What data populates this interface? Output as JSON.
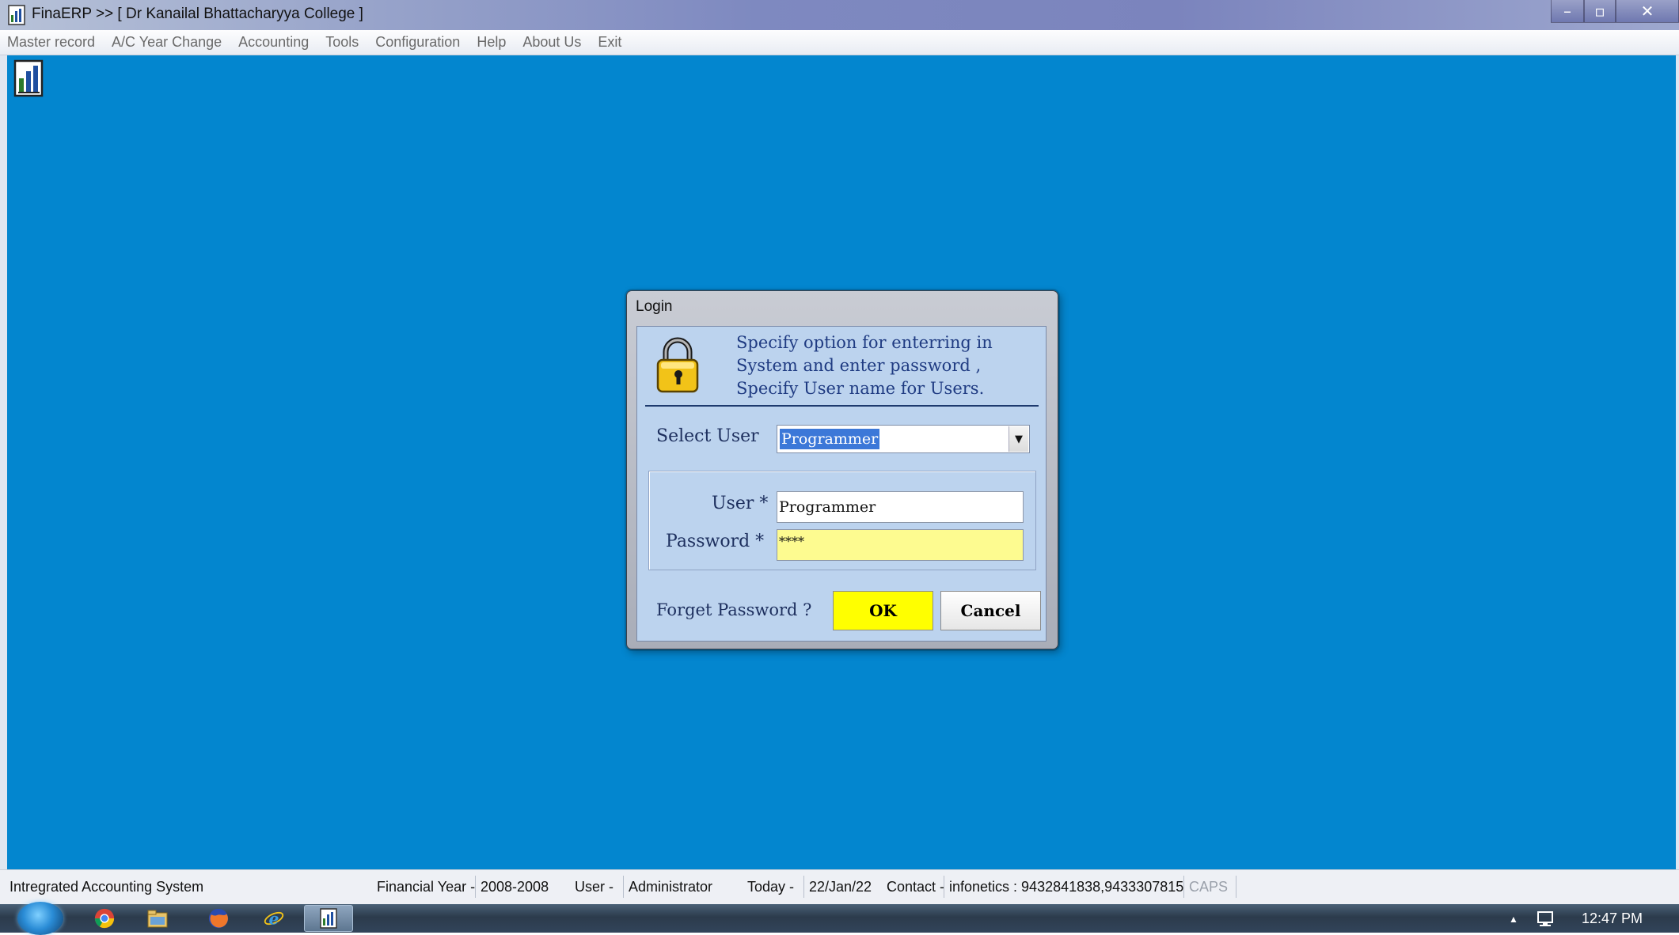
{
  "window": {
    "title": "FinaERP  >> [ Dr Kanailal Bhattacharyya College ]",
    "controls": {
      "minimize": "–",
      "maximize": "▫",
      "close": "✕"
    }
  },
  "menu": {
    "items": [
      "Master record",
      "A/C Year Change",
      "Accounting",
      "Tools",
      "Configuration",
      "Help",
      "About Us",
      "Exit"
    ]
  },
  "colors": {
    "desktop_background": "#0386cf",
    "ok_button": "#ffff00",
    "password_field": "#fdfb90",
    "info_text": "#1f3b82"
  },
  "login_dialog": {
    "title": "Login",
    "icon": "padlock-icon",
    "info_lines": [
      "Specify option for enterring in",
      "System and enter password ,",
      "Specify User name for Users."
    ],
    "select_user_label": "Select User",
    "select_user_value": "Programmer",
    "user_label": "User *",
    "user_value": "Programmer",
    "password_label": "Password *",
    "password_value": "****",
    "forget_password": "Forget Password ?",
    "ok_label": "OK",
    "cancel_label": "Cancel"
  },
  "statusbar": {
    "app_name": "Intregrated Accounting System",
    "financial_year_label": "Financial Year -",
    "financial_year_value": "2008-2008",
    "user_label": "User -",
    "user_value": "Administrator",
    "today_label": "Today -",
    "today_value": "22/Jan/22",
    "contact_label": "Contact -",
    "contact_value": "infonetics : 9432841838,9433307815",
    "caps": "CAPS"
  },
  "taskbar": {
    "icons": [
      "windows-start-icon",
      "chrome-icon",
      "file-explorer-icon",
      "firefox-icon",
      "internet-explorer-icon",
      "finaerp-icon"
    ],
    "tray_arrow": "▲",
    "clock": "12:47 PM"
  }
}
